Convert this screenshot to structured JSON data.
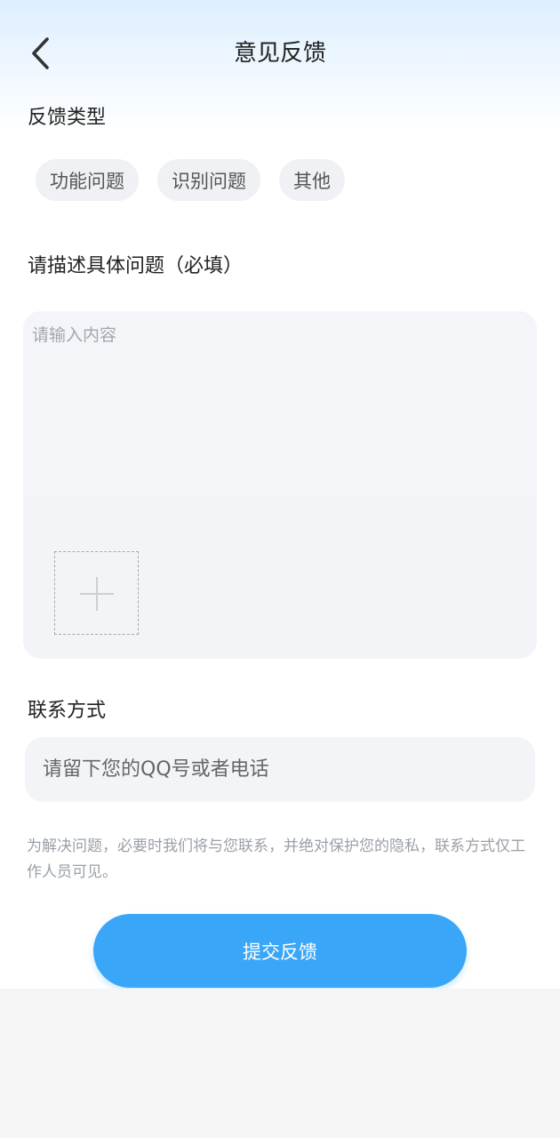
{
  "header": {
    "title": "意见反馈",
    "back_icon": "chevron-left-icon"
  },
  "feedback_type": {
    "label": "反馈类型",
    "options": [
      "功能问题",
      "识别问题",
      "其他"
    ]
  },
  "description": {
    "label": "请描述具体问题（必填）",
    "value": "",
    "placeholder": "请输入内容",
    "upload_icon": "plus-icon"
  },
  "contact": {
    "label": "联系方式",
    "value": "",
    "placeholder": "请留下您的QQ号或者电话"
  },
  "privacy_note": "为解决问题，必要时我们将与您联系，并绝对保护您的隐私，联系方式仅工作人员可见。",
  "submit": {
    "label": "提交反馈"
  },
  "colors": {
    "accent": "#3aa6f8",
    "chip_background": "#eff1f5",
    "input_background": "#f3f4f8",
    "note_text": "#9aa0a8"
  }
}
